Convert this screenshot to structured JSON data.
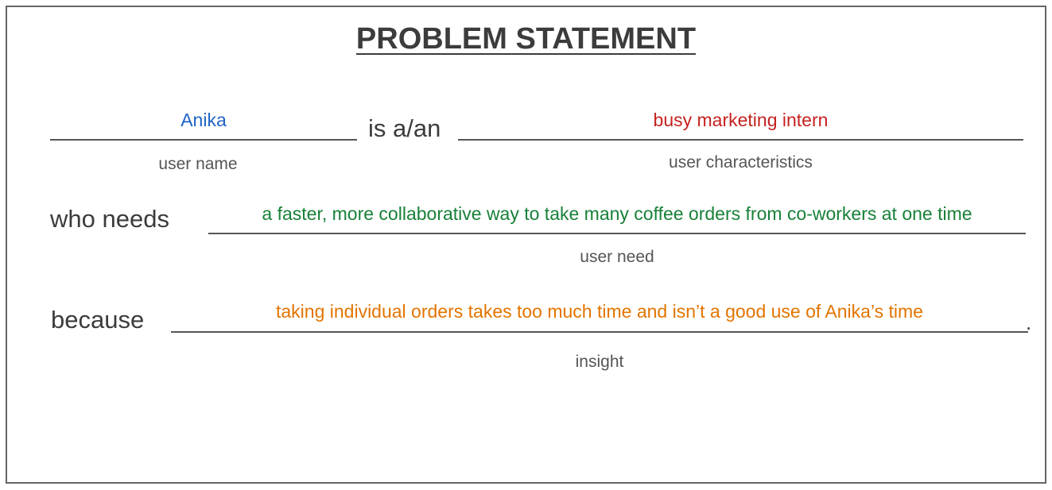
{
  "title": "PROBLEM STATEMENT",
  "row1": {
    "user_name_value": "Anika",
    "connector": "is a/an",
    "characteristics_value": "busy marketing intern",
    "user_name_caption": "user name",
    "characteristics_caption": "user characteristics"
  },
  "row2": {
    "connector": "who needs",
    "need_value": "a faster, more collaborative way to take many coffee orders from co-workers at one time",
    "need_caption": "user need"
  },
  "row3": {
    "connector": "because",
    "insight_value": "taking individual orders takes too much time and isn’t a good use of Anika’s time",
    "period": ".",
    "insight_caption": "insight"
  },
  "colors": {
    "user_name": "#1f63c6",
    "characteristics": "#c5221f",
    "need": "#188038",
    "insight": "#e37400"
  }
}
